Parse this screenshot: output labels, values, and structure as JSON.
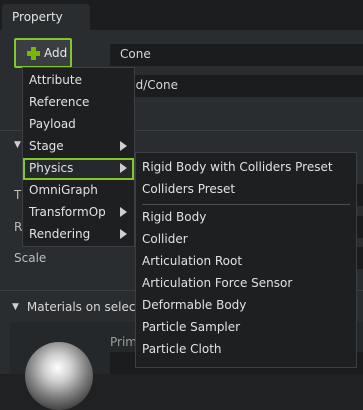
{
  "tab": {
    "title": "Property"
  },
  "add_button": {
    "label": "Add"
  },
  "fields": {
    "name_value": "Cone",
    "path_value": "orld/Cone"
  },
  "sections": {
    "left_labels": [
      "T",
      "R"
    ],
    "scale_label": "Scale"
  },
  "materials": {
    "title": "Materials on selected",
    "prim_label": "Prim"
  },
  "add_menu": {
    "items": [
      {
        "label": "Attribute",
        "submenu": false
      },
      {
        "label": "Reference",
        "submenu": false
      },
      {
        "label": "Payload",
        "submenu": false
      },
      {
        "label": "Stage",
        "submenu": true
      },
      {
        "label": "Physics",
        "submenu": true,
        "highlighted": true
      },
      {
        "label": "OmniGraph",
        "submenu": false
      },
      {
        "label": "TransformOp",
        "submenu": true
      },
      {
        "label": "Rendering",
        "submenu": true
      }
    ]
  },
  "physics_submenu": {
    "presets": [
      "Rigid Body with Colliders Preset",
      "Colliders Preset"
    ],
    "items": [
      "Rigid Body",
      "Collider",
      "Articulation Root",
      "Articulation Force Sensor",
      "Deformable Body",
      "Particle Sampler",
      "Particle Cloth"
    ]
  },
  "colors": {
    "accent": "#76b900",
    "highlight_border": "#7fc72b",
    "background": "#2a2d30"
  }
}
